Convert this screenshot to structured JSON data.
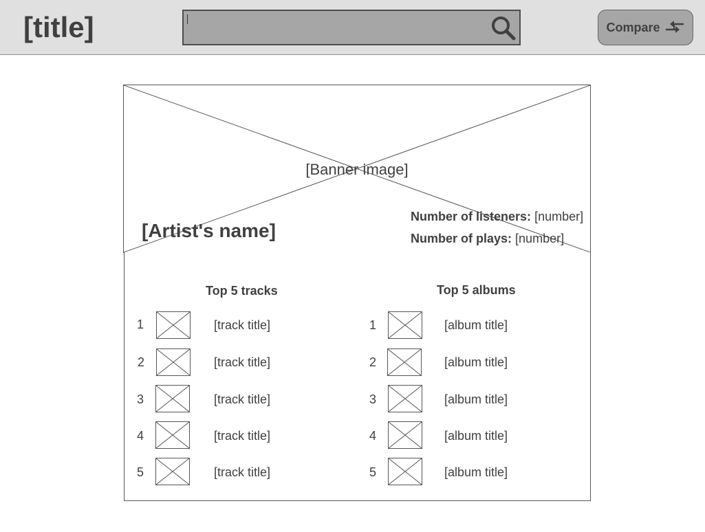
{
  "header": {
    "app_title": "[title]",
    "search_value": "",
    "compare_label": "Compare"
  },
  "banner": {
    "image_label": "[Banner image]",
    "artist_name": "[Artist's name]",
    "listeners_label": "Number of listeners:",
    "listeners_value": "[number]",
    "plays_label": "Number of plays:",
    "plays_value": "[number]"
  },
  "top_tracks": {
    "title": "Top 5 tracks",
    "items": [
      {
        "rank": "1",
        "title": "[track title]"
      },
      {
        "rank": "2",
        "title": "[track title]"
      },
      {
        "rank": "3",
        "title": "[track title]"
      },
      {
        "rank": "4",
        "title": "[track title]"
      },
      {
        "rank": "5",
        "title": "[track title]"
      }
    ]
  },
  "top_albums": {
    "title": "Top 5 albums",
    "items": [
      {
        "rank": "1",
        "title": "[album title]"
      },
      {
        "rank": "2",
        "title": "[album title]"
      },
      {
        "rank": "3",
        "title": "[album title]"
      },
      {
        "rank": "4",
        "title": "[album title]"
      },
      {
        "rank": "5",
        "title": "[album title]"
      }
    ]
  }
}
